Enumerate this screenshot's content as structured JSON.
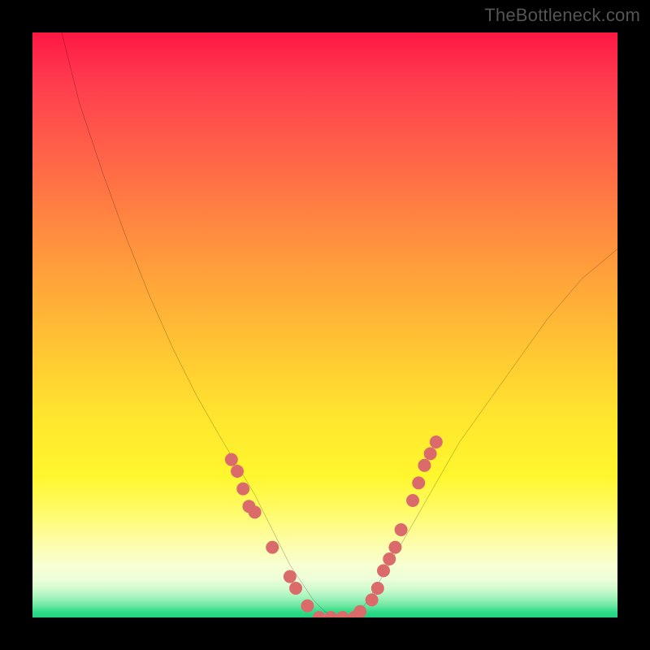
{
  "watermark": "TheBottleneck.com",
  "chart_data": {
    "type": "line",
    "title": "",
    "xlabel": "",
    "ylabel": "",
    "xlim": [
      0,
      100
    ],
    "ylim": [
      0,
      100
    ],
    "grid": false,
    "legend": false,
    "background": {
      "type": "vertical-gradient",
      "stops": [
        {
          "pos": 0,
          "color": "#ff1744"
        },
        {
          "pos": 50,
          "color": "#ffd633"
        },
        {
          "pos": 85,
          "color": "#fffb6a"
        },
        {
          "pos": 100,
          "color": "#20d07e"
        }
      ]
    },
    "series": [
      {
        "name": "bottleneck-curve",
        "x": [
          5,
          8,
          12,
          16,
          20,
          24,
          28,
          32,
          35,
          38,
          40,
          42,
          44,
          46,
          48,
          50,
          52,
          54,
          56,
          58,
          61,
          65,
          69,
          73,
          78,
          83,
          88,
          94,
          100
        ],
        "values": [
          100,
          88,
          76,
          65,
          55,
          46,
          38,
          31,
          26,
          21,
          17,
          13,
          9,
          6,
          3,
          1,
          0,
          0,
          1,
          4,
          9,
          16,
          23,
          30,
          37,
          44,
          51,
          58,
          63
        ],
        "color": "#000000",
        "stroke_width": 1.6
      }
    ],
    "scatter_points": {
      "name": "markers",
      "color": "#db6b6b",
      "radius": 8,
      "points": [
        {
          "x": 34,
          "y": 27
        },
        {
          "x": 35,
          "y": 25
        },
        {
          "x": 36,
          "y": 22
        },
        {
          "x": 37,
          "y": 19
        },
        {
          "x": 38,
          "y": 18
        },
        {
          "x": 41,
          "y": 12
        },
        {
          "x": 44,
          "y": 7
        },
        {
          "x": 45,
          "y": 5
        },
        {
          "x": 47,
          "y": 2
        },
        {
          "x": 49,
          "y": 0
        },
        {
          "x": 51,
          "y": 0
        },
        {
          "x": 53,
          "y": 0
        },
        {
          "x": 55,
          "y": 0
        },
        {
          "x": 56,
          "y": 1
        },
        {
          "x": 58,
          "y": 3
        },
        {
          "x": 59,
          "y": 5
        },
        {
          "x": 60,
          "y": 8
        },
        {
          "x": 61,
          "y": 10
        },
        {
          "x": 62,
          "y": 12
        },
        {
          "x": 63,
          "y": 15
        },
        {
          "x": 65,
          "y": 20
        },
        {
          "x": 66,
          "y": 23
        },
        {
          "x": 67,
          "y": 26
        },
        {
          "x": 68,
          "y": 28
        },
        {
          "x": 69,
          "y": 30
        }
      ]
    }
  }
}
